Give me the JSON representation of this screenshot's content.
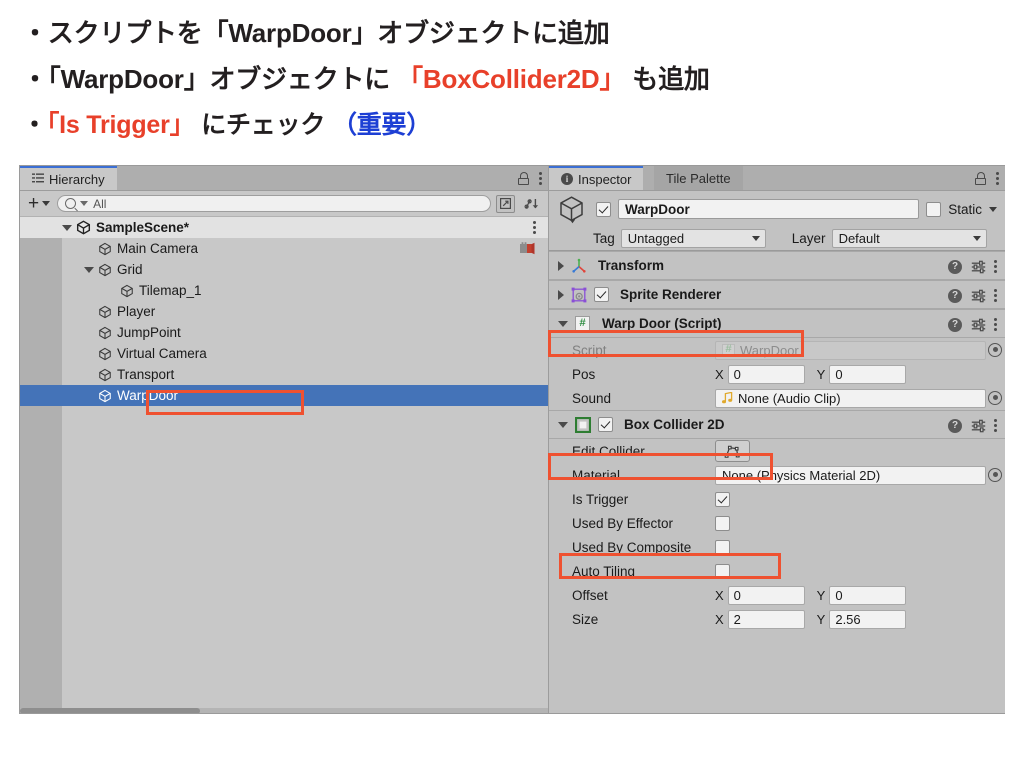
{
  "slide": {
    "bullets": [
      {
        "marker": "・",
        "parts": [
          {
            "t": "スクリプトを「WarpDoor」オブジェクトに追加",
            "c": "black"
          }
        ]
      },
      {
        "marker": "・",
        "parts": [
          {
            "t": "「WarpDoor」オブジェクトに ",
            "c": "black"
          },
          {
            "t": "「BoxCollider2D」",
            "c": "red"
          },
          {
            "t": " も追加",
            "c": "black"
          }
        ]
      },
      {
        "marker": "・",
        "parts": [
          {
            "t": "「Is Trigger」",
            "c": "red"
          },
          {
            "t": " にチェック ",
            "c": "black"
          },
          {
            "t": "（重要）",
            "c": "blue"
          }
        ]
      }
    ],
    "line1_full": "・スクリプトを「WarpDoor」オブジェクトに追加",
    "line2_a": "・「WarpDoor」オブジェクトに ",
    "line2_b": "「BoxCollider2D」",
    "line2_c": " も追加",
    "line3_a": "・",
    "line3_b": "「Is Trigger」",
    "line3_c": " にチェック ",
    "line3_d": "（重要）",
    "accent_red": "#e8402a",
    "accent_blue": "#1d3fd4",
    "annotation_red": "#ef5130"
  },
  "hierarchy": {
    "tab_label": "Hierarchy",
    "toolbar": {
      "add_label": "+",
      "search_placeholder": "All",
      "search_value": ""
    },
    "tree": [
      {
        "label": "SampleScene*",
        "depth": 0,
        "icon": "scene-icon",
        "expanded": true,
        "selected": false,
        "bold": true,
        "badge": "",
        "menu": true
      },
      {
        "label": "Main Camera",
        "depth": 1,
        "icon": "gameobject-icon",
        "expanded": null,
        "selected": false,
        "bold": false,
        "badge": "camera-preview-icon",
        "menu": false
      },
      {
        "label": "Grid",
        "depth": 1,
        "icon": "gameobject-icon",
        "expanded": true,
        "selected": false,
        "bold": false,
        "badge": "",
        "menu": false
      },
      {
        "label": "Tilemap_1",
        "depth": 2,
        "icon": "gameobject-icon",
        "expanded": null,
        "selected": false,
        "bold": false,
        "badge": "",
        "menu": false
      },
      {
        "label": "Player",
        "depth": 1,
        "icon": "gameobject-icon",
        "expanded": null,
        "selected": false,
        "bold": false,
        "badge": "",
        "menu": false
      },
      {
        "label": "JumpPoint",
        "depth": 1,
        "icon": "gameobject-icon",
        "expanded": null,
        "selected": false,
        "bold": false,
        "badge": "",
        "menu": false
      },
      {
        "label": "Virtual Camera",
        "depth": 1,
        "icon": "gameobject-icon",
        "expanded": null,
        "selected": false,
        "bold": false,
        "badge": "",
        "menu": false
      },
      {
        "label": "Transport",
        "depth": 1,
        "icon": "gameobject-icon",
        "expanded": null,
        "selected": false,
        "bold": false,
        "badge": "",
        "menu": false
      },
      {
        "label": "WarpDoor",
        "depth": 1,
        "icon": "gameobject-icon",
        "expanded": null,
        "selected": true,
        "bold": false,
        "badge": "",
        "menu": false
      }
    ]
  },
  "inspector": {
    "tabs": [
      {
        "label": "Inspector",
        "active": true
      },
      {
        "label": "Tile Palette",
        "active": false
      }
    ],
    "object_header": {
      "enabled": true,
      "name": "WarpDoor",
      "static_label": "Static",
      "static_checked": false,
      "tag_label": "Tag",
      "tag_value": "Untagged",
      "layer_label": "Layer",
      "layer_value": "Default"
    },
    "components": [
      {
        "title": "Transform",
        "icon": "transform-icon",
        "expanded": false,
        "has_enable_checkbox": false,
        "enabled": false,
        "highlight": false,
        "rows": []
      },
      {
        "title": "Sprite Renderer",
        "icon": "sprite-renderer-icon",
        "expanded": false,
        "has_enable_checkbox": true,
        "enabled": true,
        "highlight": false,
        "rows": []
      },
      {
        "title": "Warp Door (Script)",
        "icon": "script-icon",
        "expanded": true,
        "has_enable_checkbox": false,
        "enabled": false,
        "highlight": true,
        "rows": [
          {
            "type": "object",
            "name": "Script",
            "dim": true,
            "icon": "script-icon",
            "value": "WarpDoor",
            "picker": true
          },
          {
            "type": "vector2",
            "name": "Pos",
            "dim": false,
            "x_label": "X",
            "x": "0",
            "y_label": "Y",
            "y": "0"
          },
          {
            "type": "object",
            "name": "Sound",
            "dim": false,
            "icon": "audio-clip-icon",
            "value": "None (Audio Clip)",
            "picker": true
          }
        ]
      },
      {
        "title": "Box Collider 2D",
        "icon": "box-collider-2d-icon",
        "expanded": true,
        "has_enable_checkbox": true,
        "enabled": true,
        "highlight": true,
        "rows": [
          {
            "type": "button",
            "name": "Edit Collider",
            "dim": false,
            "button_icon": "edit-collider-icon"
          },
          {
            "type": "object",
            "name": "Material",
            "dim": false,
            "icon": "",
            "value": "None (Physics Material 2D)",
            "picker": true
          },
          {
            "type": "checkbox",
            "name": "Is Trigger",
            "dim": false,
            "checked": true,
            "highlight": true
          },
          {
            "type": "checkbox",
            "name": "Used By Effector",
            "dim": false,
            "checked": false,
            "highlight": false
          },
          {
            "type": "checkbox",
            "name": "Used By Composite",
            "dim": false,
            "checked": false,
            "highlight": false
          },
          {
            "type": "checkbox",
            "name": "Auto Tiling",
            "dim": false,
            "checked": false,
            "highlight": false
          },
          {
            "type": "vector2",
            "name": "Offset",
            "dim": false,
            "x_label": "X",
            "x": "0",
            "y_label": "Y",
            "y": "0"
          },
          {
            "type": "vector2",
            "name": "Size",
            "dim": false,
            "x_label": "X",
            "x": "2",
            "y_label": "Y",
            "y": "2.56"
          }
        ]
      }
    ]
  }
}
